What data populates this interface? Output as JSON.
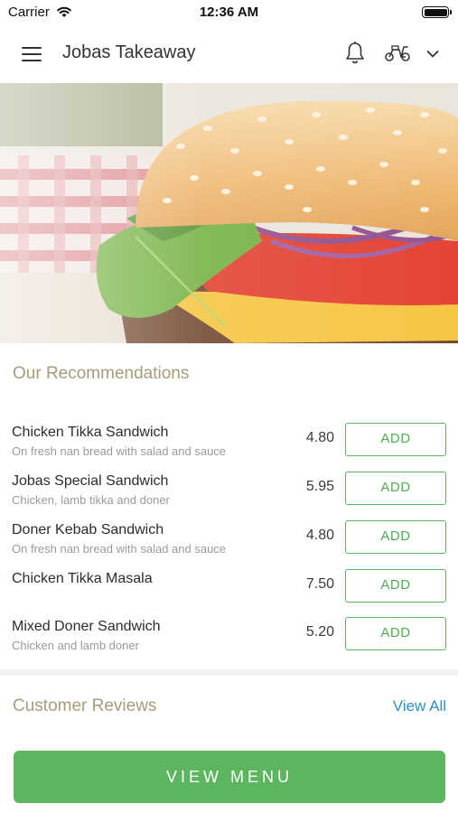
{
  "status_bar": {
    "carrier": "Carrier",
    "time": "12:36 AM"
  },
  "header": {
    "title": "Jobas Takeaway",
    "icons": [
      "menu-icon",
      "bell-icon",
      "scooter-icon",
      "chevron-down-icon"
    ]
  },
  "recommendations": {
    "title": "Our Recommendations",
    "add_label": "ADD",
    "items": [
      {
        "name": "Chicken Tikka Sandwich",
        "description": "On fresh nan bread with salad and sauce",
        "price": "4.80"
      },
      {
        "name": "Jobas Special Sandwich",
        "description": "Chicken, lamb tikka and doner",
        "price": "5.95"
      },
      {
        "name": "Doner Kebab Sandwich",
        "description": "On fresh nan bread with salad and sauce",
        "price": "4.80"
      },
      {
        "name": "Chicken Tikka Masala",
        "description": "",
        "price": "7.50"
      },
      {
        "name": "Mixed Doner Sandwich",
        "description": "Chicken and lamb doner",
        "price": "5.20"
      }
    ]
  },
  "reviews": {
    "title": "Customer Reviews",
    "view_all": "View All"
  },
  "footer": {
    "view_menu": "VIEW MENU"
  },
  "colors": {
    "accent_green": "#5cb65f",
    "section_title": "#a79b7a",
    "link_blue": "#2d8fc4"
  }
}
